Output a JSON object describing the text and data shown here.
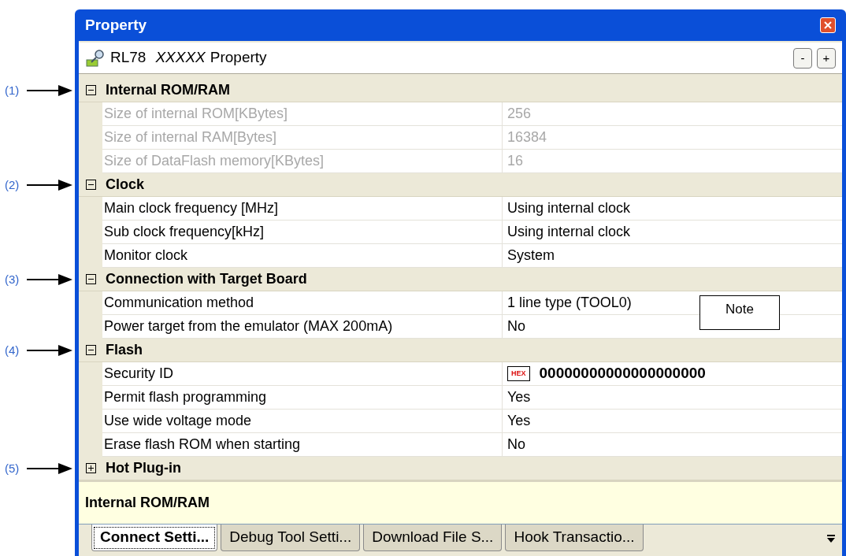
{
  "window": {
    "title": "Property"
  },
  "header": {
    "device": "RL78",
    "model": "XXXXX",
    "suffix": "Property",
    "buttons": [
      "-",
      "+"
    ]
  },
  "categories": [
    {
      "annotation": "(1)",
      "name": "Internal ROM/RAM",
      "expanded": true,
      "properties": [
        {
          "name": "Size of internal ROM[KBytes]",
          "value": "256",
          "disabled": true,
          "kind": "text"
        },
        {
          "name": "Size of internal RAM[Bytes]",
          "value": "16384",
          "disabled": true,
          "kind": "text"
        },
        {
          "name": "Size of DataFlash memory[KBytes]",
          "value": "16",
          "disabled": true,
          "kind": "text"
        }
      ]
    },
    {
      "annotation": "(2)",
      "name": "Clock",
      "expanded": true,
      "properties": [
        {
          "name": "Main clock frequency [MHz]",
          "value": "Using internal clock",
          "disabled": false,
          "kind": "text"
        },
        {
          "name": "Sub clock frequency[kHz]",
          "value": "Using internal clock",
          "disabled": false,
          "kind": "text"
        },
        {
          "name": "Monitor clock",
          "value": "System",
          "disabled": false,
          "kind": "text"
        }
      ]
    },
    {
      "annotation": "(3)",
      "name": "Connection with Target Board",
      "expanded": true,
      "properties": [
        {
          "name": "Communication method",
          "value": "1 line type (TOOL0)",
          "disabled": false,
          "kind": "text"
        },
        {
          "name": "Power target from the emulator (MAX 200mA)",
          "value": "No",
          "disabled": false,
          "kind": "text"
        }
      ]
    },
    {
      "annotation": "(4)",
      "name": "Flash",
      "expanded": true,
      "properties": [
        {
          "name": "Security ID",
          "value": "00000000000000000000",
          "badge": "HEX",
          "disabled": false,
          "kind": "hex"
        },
        {
          "name": "Permit flash programming",
          "value": "Yes",
          "disabled": false,
          "kind": "text"
        },
        {
          "name": "Use wide voltage mode",
          "value": "Yes",
          "disabled": false,
          "kind": "text"
        },
        {
          "name": "Erase flash ROM when starting",
          "value": "No",
          "disabled": false,
          "kind": "text"
        }
      ]
    },
    {
      "annotation": "(5)",
      "name": "Hot Plug-in",
      "expanded": false
    }
  ],
  "note": "Note",
  "description": "Internal ROM/RAM",
  "tabs": [
    {
      "label": "Connect Setti...",
      "selected": true
    },
    {
      "label": "Debug Tool Setti...",
      "selected": false
    },
    {
      "label": "Download File S...",
      "selected": false
    },
    {
      "label": "Hook Transactio...",
      "selected": false
    }
  ]
}
